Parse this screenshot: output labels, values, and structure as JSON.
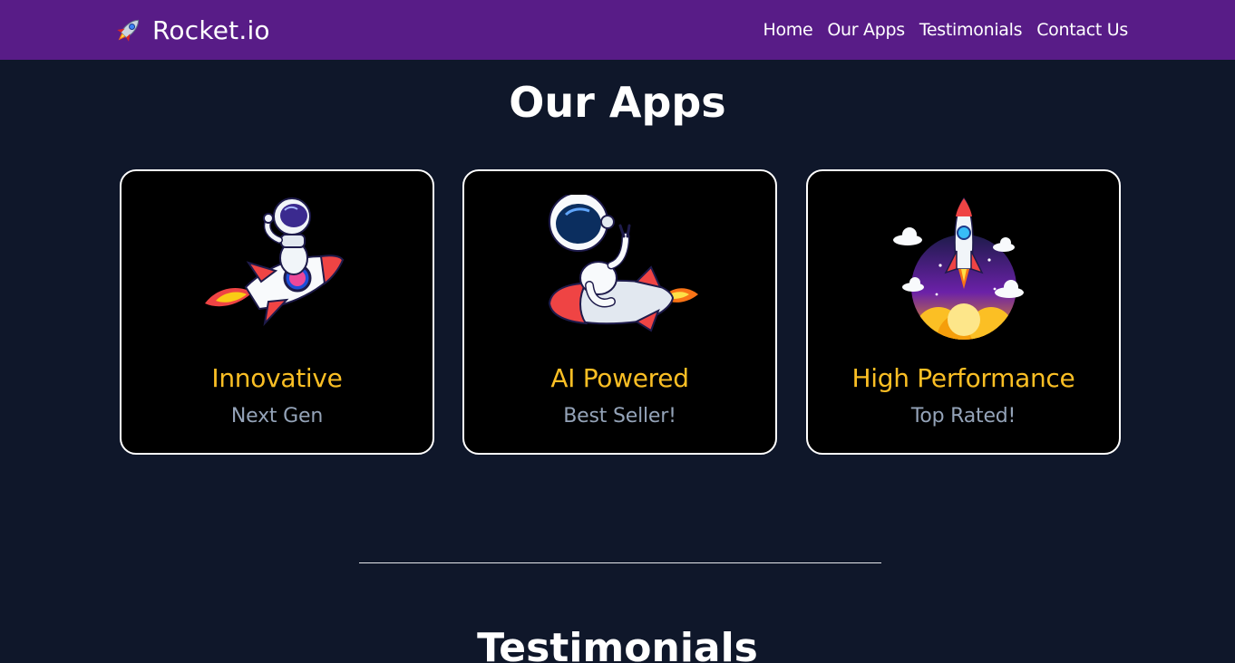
{
  "nav": {
    "brand": "Rocket.io",
    "brand_icon": "rocket-icon",
    "links": [
      "Home",
      "Our Apps",
      "Testimonials",
      "Contact Us"
    ]
  },
  "apps": {
    "title": "Our Apps",
    "cards": [
      {
        "title": "Innovative",
        "subtitle": "Next Gen",
        "image": "astronaut-riding-rocket-illustration"
      },
      {
        "title": "AI Powered",
        "subtitle": "Best Seller!",
        "image": "astronaut-peace-sign-rocket-illustration"
      },
      {
        "title": "High Performance",
        "subtitle": "Top Rated!",
        "image": "rocket-launch-illustration"
      }
    ]
  },
  "testimonials": {
    "title": "Testimonials"
  },
  "colors": {
    "navbar": "#581c87",
    "background": "#0f172a",
    "card_title": "#fbbf24",
    "card_subtitle": "#94a3b8"
  }
}
